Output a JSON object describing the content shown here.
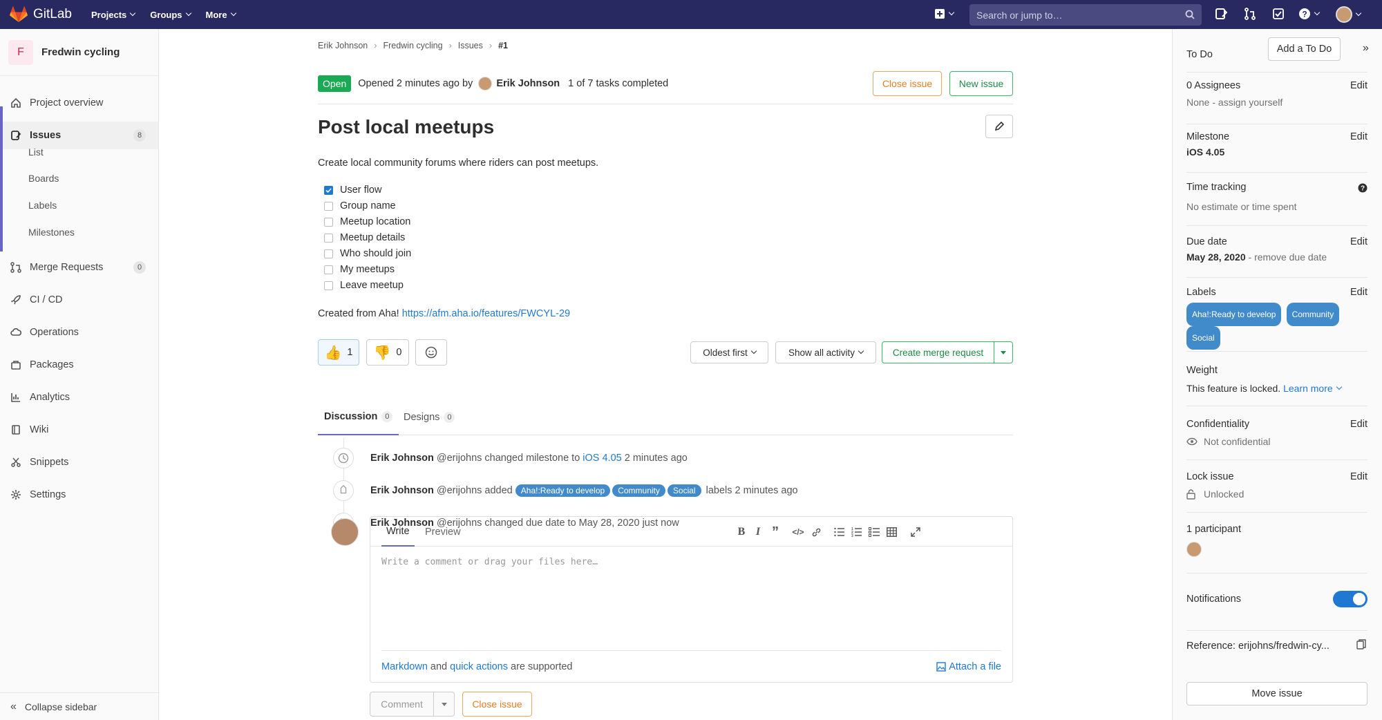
{
  "topbar": {
    "logo_text": "GitLab",
    "nav": [
      "Projects",
      "Groups",
      "More"
    ],
    "search_placeholder": "Search or jump to…"
  },
  "sidebar": {
    "project_initial": "F",
    "project_name": "Fredwin cycling",
    "items": {
      "overview": "Project overview",
      "issues": "Issues",
      "issues_count": "8",
      "list": "List",
      "boards": "Boards",
      "labels": "Labels",
      "milestones": "Milestones",
      "merge_requests": "Merge Requests",
      "mr_count": "0",
      "cicd": "CI / CD",
      "operations": "Operations",
      "packages": "Packages",
      "analytics": "Analytics",
      "wiki": "Wiki",
      "snippets": "Snippets",
      "settings": "Settings"
    },
    "collapse": "Collapse sidebar"
  },
  "breadcrumb": [
    "Erik Johnson",
    "Fredwin cycling",
    "Issues",
    "#1"
  ],
  "issue": {
    "status": "Open",
    "opened": "Opened 2 minutes ago by",
    "author": "Erik Johnson",
    "tasks": "1 of 7 tasks completed",
    "close_btn": "Close issue",
    "new_btn": "New issue",
    "title": "Post local meetups",
    "description": "Create local community forums where riders can post meetups.",
    "tasklist": [
      {
        "label": "User flow",
        "checked": true
      },
      {
        "label": "Group name",
        "checked": false
      },
      {
        "label": "Meetup location",
        "checked": false
      },
      {
        "label": "Meetup details",
        "checked": false
      },
      {
        "label": "Who should join",
        "checked": false
      },
      {
        "label": "My meetups",
        "checked": false
      },
      {
        "label": "Leave meetup",
        "checked": false
      }
    ],
    "created_from": "Created from Aha!",
    "link": "https://afm.aha.io/features/FWCYL-29"
  },
  "awards": {
    "thumbsup": "1",
    "thumbsdown": "0"
  },
  "controls": {
    "sort": "Oldest first",
    "filter": "Show all activity",
    "create_mr": "Create merge request"
  },
  "tabs": {
    "discussion": "Discussion",
    "discussion_count": "0",
    "designs": "Designs",
    "designs_count": "0"
  },
  "notes": [
    {
      "author": "Erik Johnson",
      "handle": "@erijohns",
      "pre": "changed milestone to",
      "link": "iOS 4.05",
      "post": "2 minutes ago"
    },
    {
      "author": "Erik Johnson",
      "handle": "@erijohns",
      "pre": "added",
      "labels": [
        "Aha!:Ready to develop",
        "Community",
        "Social"
      ],
      "post": "labels 2 minutes ago"
    },
    {
      "author": "Erik Johnson",
      "handle": "@erijohns",
      "pre": "changed due date to May 28, 2020 just now"
    }
  ],
  "editor": {
    "write": "Write",
    "preview": "Preview",
    "placeholder": "Write a comment or drag your files here…",
    "markdown": "Markdown",
    "and": "and",
    "quick_actions": "quick actions",
    "supported": "are supported",
    "attach": "Attach a file",
    "comment_btn": "Comment",
    "close_btn": "Close issue"
  },
  "right": {
    "todo": "To Do",
    "add_todo": "Add a To Do",
    "assignees_title": "0 Assignees",
    "assignees_value": "None - assign yourself",
    "edit": "Edit",
    "milestone_title": "Milestone",
    "milestone_value": "iOS 4.05",
    "time_title": "Time tracking",
    "time_value": "No estimate or time spent",
    "due_title": "Due date",
    "due_value": "May 28, 2020",
    "due_remove": "- remove due date",
    "labels_title": "Labels",
    "labels": [
      "Aha!:Ready to develop",
      "Community",
      "Social"
    ],
    "weight_title": "Weight",
    "weight_value": "This feature is locked.",
    "learn_more": "Learn more",
    "conf_title": "Confidentiality",
    "conf_value": "Not confidential",
    "lock_title": "Lock issue",
    "lock_value": "Unlocked",
    "participants": "1 participant",
    "notifications": "Notifications",
    "reference": "Reference: erijohns/fredwin-cy...",
    "move": "Move issue"
  },
  "colors": {
    "topbar": "#292961",
    "accent": "#6666c4",
    "open": "#1aaa55",
    "label": "#428bca",
    "link": "#1f78d1",
    "warn": "#e67e22"
  }
}
